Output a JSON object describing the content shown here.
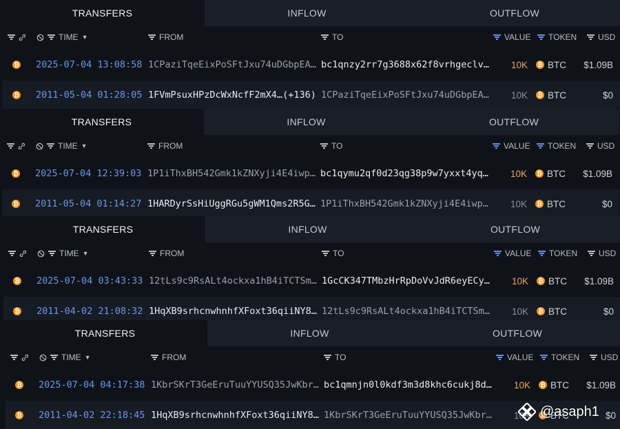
{
  "tabs": {
    "transfers": "TRANSFERS",
    "inflow": "INFLOW",
    "outflow": "OUTFLOW"
  },
  "headers": {
    "time": "TIME",
    "from": "FROM",
    "to": "TO",
    "value": "VALUE",
    "token": "TOKEN",
    "usd": "USD"
  },
  "colors": {
    "time": "#6a97e6",
    "value_high": "#f0a35e",
    "coin": "#f7931a",
    "inactive_tab": "#1a1f27"
  },
  "panels": [
    {
      "rows": [
        {
          "time": "2025-07-04 13:08:58",
          "from": "1CPaziTqeEixPoSFtJxu74uDGbpEA…",
          "to": "bc1qnzy2rr7g3688x62f8vrhgeclv…",
          "value": "10K",
          "token": "BTC",
          "usd": "$1.09B"
        },
        {
          "time": "2011-05-04 01:28:05",
          "from": "1FVmPsuxHPzDcWxNcfF2mX4…(+136)",
          "to": "1CPaziTqeEixPoSFtJxu74uDGbpEA…",
          "value": "10K",
          "token": "BTC",
          "usd": "$0"
        }
      ]
    },
    {
      "rows": [
        {
          "time": "2025-07-04 12:39:03",
          "from": "1P1iThxBH542Gmk1kZNXyji4E4iwp…",
          "to": "bc1qymu2qf0d23qg38p9w7yxxt4yq…",
          "value": "10K",
          "token": "BTC",
          "usd": "$1.09B"
        },
        {
          "time": "2011-05-04 01:14:27",
          "from": "1HARDyrSsHiUggRGu5gWM1Qms2R5G…",
          "to": "1P1iThxBH542Gmk1kZNXyji4E4iwp…",
          "value": "10K",
          "token": "BTC",
          "usd": "$0"
        }
      ]
    },
    {
      "rows": [
        {
          "time": "2025-07-04 03:43:33",
          "from": "12tLs9c9RsALt4ockxa1hB4iTCTSm…",
          "to": "1GcCK347TMbzHrRpDoVvJdR6eyECy…",
          "value": "10K",
          "token": "BTC",
          "usd": "$1.09B"
        },
        {
          "time": "2011-04-02 21:08:32",
          "from": "1HqXB9srhcnwhnhfXFoxt36qiiNY8…",
          "to": "12tLs9c9RsALt4ockxa1hB4iTCTSm…",
          "value": "10K",
          "token": "BTC",
          "usd": "$0"
        }
      ]
    },
    {
      "rows": [
        {
          "time": "2025-07-04 04:17:38",
          "from": "1KbrSKrT3GeEruTuuYYUSQ35JwKbr…",
          "to": "bc1qmnjn0l0kdf3m3d8khc6cukj8d…",
          "value": "10K",
          "token": "BTC",
          "usd": "$1.09B"
        },
        {
          "time": "2011-04-02 22:18:45",
          "from": "1HqXB9srhcnwhnhfXFoxt36qiiNY8…",
          "to": "1KbrSKrT3GeEruTuuYYUSQ35JwKbr…",
          "value": "10K",
          "token": "BTC",
          "usd": "$0"
        }
      ]
    }
  ],
  "coin_glyph": "₿",
  "watermark": "@asaph1"
}
